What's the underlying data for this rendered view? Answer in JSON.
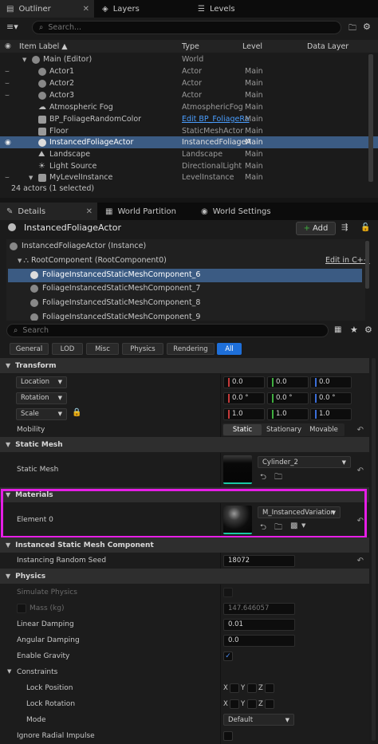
{
  "outliner": {
    "tabs": [
      {
        "label": "Outliner",
        "active": true
      },
      {
        "label": "Layers",
        "active": false
      },
      {
        "label": "Levels",
        "active": false
      }
    ],
    "search_placeholder": "Search...",
    "columns": {
      "label": "Item Label ▲",
      "type": "Type",
      "level": "Level",
      "data_layer": "Data Layer"
    },
    "rows": [
      {
        "name": "Main (Editor)",
        "type": "World",
        "level": ""
      },
      {
        "name": "Actor1",
        "type": "Actor",
        "level": "Main"
      },
      {
        "name": "Actor2",
        "type": "Actor",
        "level": "Main"
      },
      {
        "name": "Actor3",
        "type": "Actor",
        "level": "Main"
      },
      {
        "name": "Atmospheric Fog",
        "type": "AtmosphericFog",
        "level": "Main"
      },
      {
        "name": "BP_FoliageRandomColor",
        "type": "Edit BP_FoliageRa",
        "level": "Main"
      },
      {
        "name": "Floor",
        "type": "StaticMeshActor",
        "level": "Main"
      },
      {
        "name": "InstancedFoliageActor",
        "type": "InstancedFoliageA",
        "level": "Main"
      },
      {
        "name": "Landscape",
        "type": "Landscape",
        "level": "Main"
      },
      {
        "name": "Light Source",
        "type": "DirectionalLight",
        "level": "Main"
      },
      {
        "name": "MyLevelInstance",
        "type": "LevelInstance",
        "level": "Main"
      }
    ],
    "status": "24 actors (1 selected)"
  },
  "details": {
    "tabs": [
      {
        "label": "Details",
        "active": true
      },
      {
        "label": "World Partition",
        "active": false
      },
      {
        "label": "World Settings",
        "active": false
      }
    ],
    "actor_name": "InstancedFoliageActor",
    "add_label": "Add",
    "tree": {
      "instance": "InstancedFoliageActor (Instance)",
      "root": "RootComponent (RootComponent0)",
      "edit_cpp": "Edit in C++",
      "components": [
        "FoliageInstancedStaticMeshComponent_6",
        "FoliageInstancedStaticMeshComponent_7",
        "FoliageInstancedStaticMeshComponent_8",
        "FoliageInstancedStaticMeshComponent_9"
      ]
    },
    "search_placeholder": "Search",
    "filters": [
      "General",
      "LOD",
      "Misc",
      "Physics",
      "Rendering",
      "All"
    ],
    "sections": {
      "transform": "Transform",
      "static_mesh": "Static Mesh",
      "materials": "Materials",
      "ism": "Instanced Static Mesh Component",
      "physics": "Physics"
    },
    "transform": {
      "location_label": "Location",
      "location": [
        "0.0",
        "0.0",
        "0.0"
      ],
      "rotation_label": "Rotation",
      "rotation": [
        "0.0 °",
        "0.0 °",
        "0.0 °"
      ],
      "scale_label": "Scale",
      "scale": [
        "1.0",
        "1.0",
        "1.0"
      ],
      "mobility_label": "Mobility",
      "mobility_options": [
        "Static",
        "Stationary",
        "Movable"
      ],
      "mobility_selected": "Static"
    },
    "static_mesh": {
      "label": "Static Mesh",
      "value": "Cylinder_2"
    },
    "materials": {
      "label": "Element 0",
      "value": "M_InstancedVariation"
    },
    "ism": {
      "label": "Instancing Random Seed",
      "value": "18072"
    },
    "physics": {
      "simulate": "Simulate Physics",
      "mass": "Mass (kg)",
      "mass_value": "147.646057",
      "linear_damping": "Linear Damping",
      "linear_damping_value": "0.01",
      "angular_damping": "Angular Damping",
      "angular_damping_value": "0.0",
      "enable_gravity": "Enable Gravity",
      "constraints": "Constraints",
      "lock_position": "Lock Position",
      "lock_rotation": "Lock Rotation",
      "mode": "Mode",
      "mode_value": "Default",
      "ignore_radial_impulse": "Ignore Radial Impulse",
      "axes": [
        "X",
        "Y",
        "Z"
      ]
    }
  },
  "colors": {
    "selection": "#3b5b83",
    "accent": "#1e6fd9",
    "highlight_border": "#e61ee6",
    "x_axis": "#c43a3a",
    "y_axis": "#3fae3f",
    "z_axis": "#3b6ed8",
    "link": "#4a9eff"
  }
}
